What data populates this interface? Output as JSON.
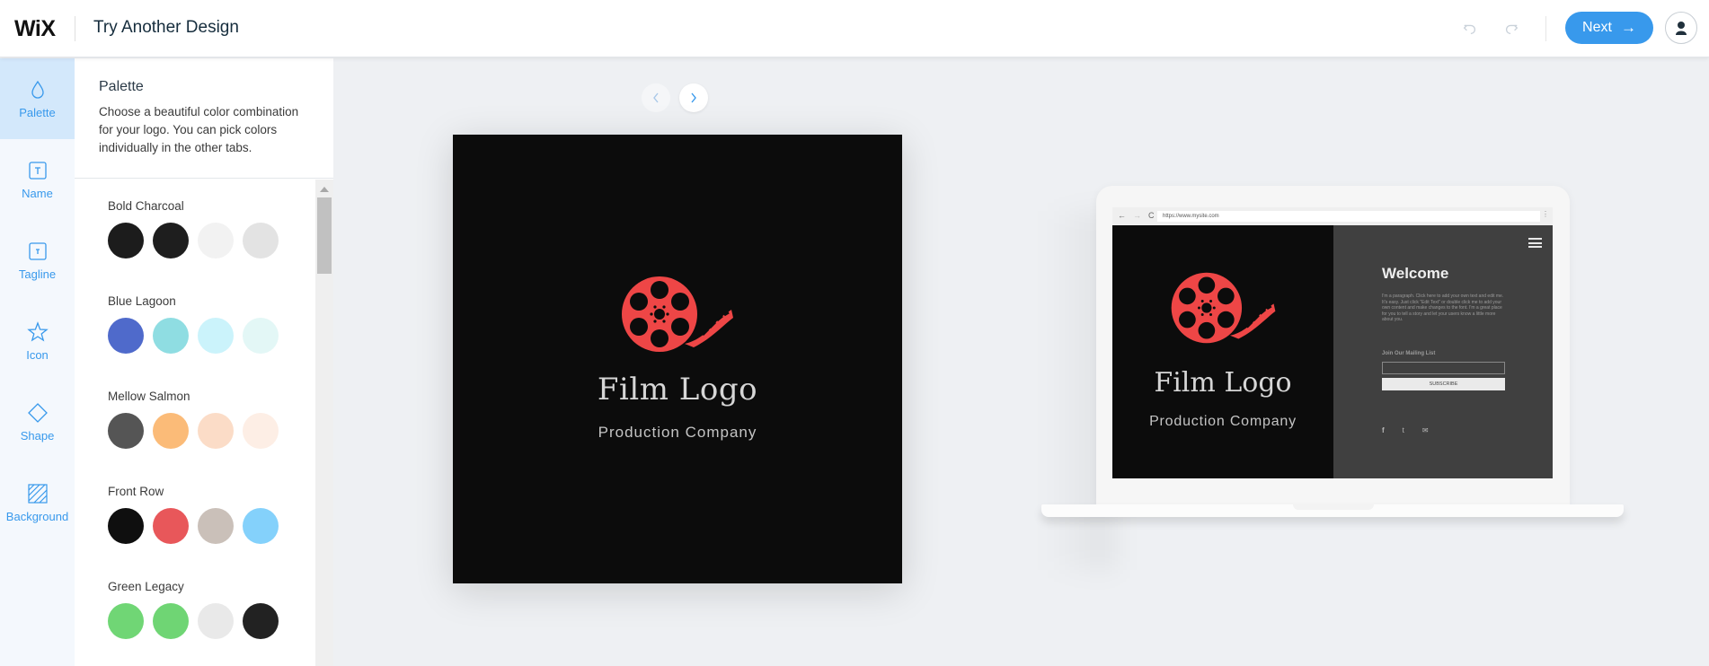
{
  "header": {
    "brand": "WiX",
    "title": "Try Another Design",
    "next_label": "Next",
    "next_arrow": "→",
    "accent_color": "#3899ec"
  },
  "rail": {
    "items": [
      {
        "label": "Palette",
        "icon": "drop-icon",
        "active": true
      },
      {
        "label": "Name",
        "icon": "text-box-icon"
      },
      {
        "label": "Tagline",
        "icon": "text-box-small-icon"
      },
      {
        "label": "Icon",
        "icon": "star-icon"
      },
      {
        "label": "Shape",
        "icon": "diamond-icon"
      },
      {
        "label": "Background",
        "icon": "hatched-square-icon"
      }
    ]
  },
  "panel": {
    "title": "Palette",
    "description": "Choose a beautiful color combination for your logo. You can pick colors individually in the other tabs.",
    "palettes": [
      {
        "name": "Bold Charcoal",
        "colors": [
          "#1c1c1c",
          "#1e1e1e",
          "#f2f2f2",
          "#e3e3e3"
        ]
      },
      {
        "name": "Blue Lagoon",
        "colors": [
          "#4f6acb",
          "#8fdde2",
          "#cbf3fb",
          "#e3f7f6"
        ]
      },
      {
        "name": "Mellow Salmon",
        "colors": [
          "#555555",
          "#fbbb78",
          "#fbdcc7",
          "#fdeee5"
        ]
      },
      {
        "name": "Front Row",
        "colors": [
          "#0f0f0f",
          "#e8575a",
          "#cac0b9",
          "#84d1fb"
        ]
      },
      {
        "name": "Green Legacy",
        "colors": [
          "#70d675",
          "#6fd574",
          "#e9e9e9",
          "#222222"
        ]
      }
    ]
  },
  "logo": {
    "name": "Film Logo",
    "tagline": "Production Company",
    "background": "#0c0c0c",
    "icon_color": "#ee4646",
    "icon": "film-reel-icon"
  },
  "mockup": {
    "url": "https://www.mysite.com",
    "welcome": "Welcome",
    "paragraph": "I'm a paragraph. Click here to add your own text and edit me. It's easy. Just click \"Edit Text\" or double click me to add your own content and make changes to the font. I'm a great place for you to tell a story and let your users know a little more about you.",
    "mailing_label": "Join Our Mailing List",
    "subscribe_label": "SUBSCRIBE",
    "nav_back": "←",
    "nav_forward": "→",
    "nav_reload": "C",
    "kebab": "⋮",
    "social": [
      "f",
      "t",
      "✉"
    ]
  }
}
